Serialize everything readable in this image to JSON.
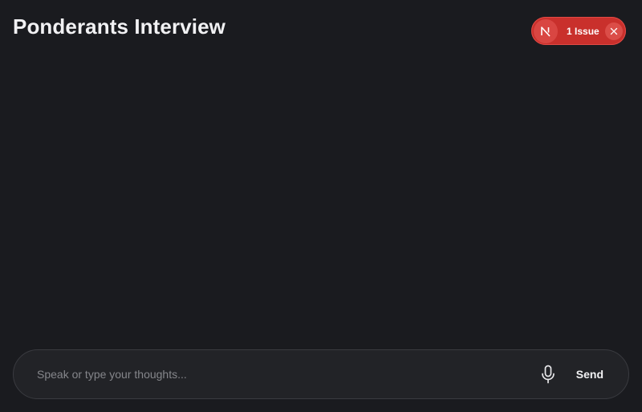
{
  "header": {
    "title": "Ponderants Interview"
  },
  "issue_badge": {
    "logo_letter": "N",
    "label": "1 Issue",
    "close_icon": "close-icon"
  },
  "composer": {
    "placeholder": "Speak or type your thoughts...",
    "value": "",
    "mic_icon": "microphone-icon",
    "send_label": "Send"
  },
  "colors": {
    "background": "#1a1b1f",
    "badge": "#c9302c",
    "composer_bg": "#222327",
    "composer_border": "#3a3b40",
    "text": "#f1f1f3",
    "placeholder": "#85868b"
  }
}
